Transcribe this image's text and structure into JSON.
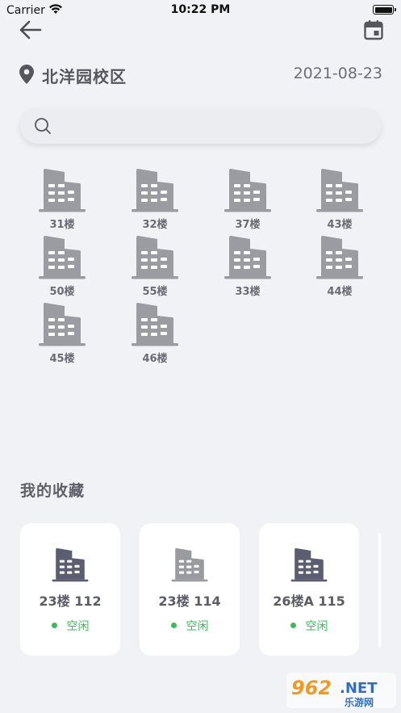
{
  "status_bar": {
    "carrier": "Carrier",
    "time": "10:22 PM"
  },
  "header": {
    "campus": "北洋园校区",
    "date": "2021-08-23"
  },
  "search": {
    "placeholder": ""
  },
  "buildings": [
    {
      "label": "31楼"
    },
    {
      "label": "32楼"
    },
    {
      "label": "37楼"
    },
    {
      "label": "43楼"
    },
    {
      "label": "50楼"
    },
    {
      "label": "55楼"
    },
    {
      "label": "33楼"
    },
    {
      "label": "44楼"
    },
    {
      "label": "45楼"
    },
    {
      "label": "46楼"
    }
  ],
  "favorites": {
    "title": "我的收藏",
    "items": [
      {
        "name": "23楼 112",
        "status": "空闲",
        "icon_color": "#5b5e70"
      },
      {
        "name": "23楼 114",
        "status": "空闲",
        "icon_color": "#9a9ba0"
      },
      {
        "name": "26楼A 115",
        "status": "空闲",
        "icon_color": "#5b5e70"
      }
    ]
  },
  "colors": {
    "building_icon": "#9b9ca1",
    "status_free": "#3dbb5c",
    "background": "#f0f2f5"
  },
  "watermark": {
    "text1": "962",
    "text2": ".NET",
    "text3": "乐游网"
  }
}
